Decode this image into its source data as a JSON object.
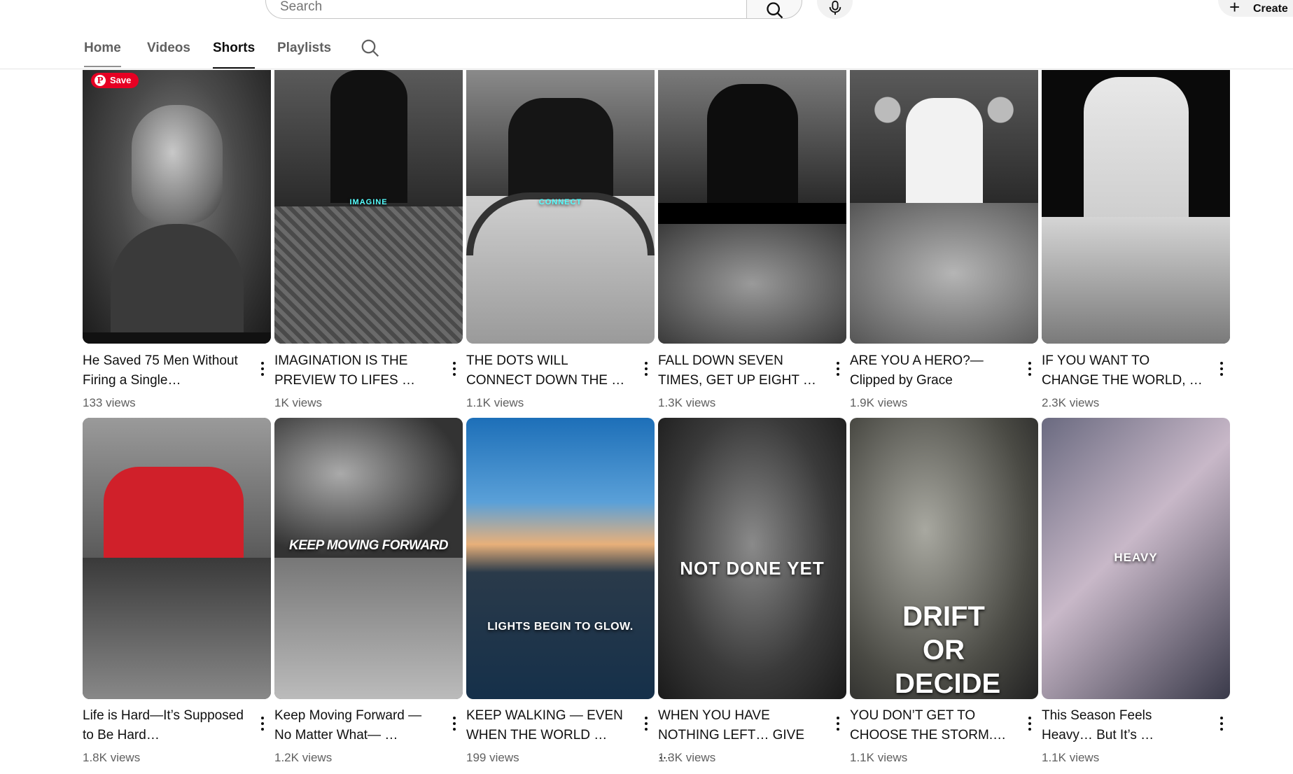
{
  "header": {
    "search_placeholder": "Search",
    "create_label": "Create"
  },
  "tabs": [
    {
      "label": "Home"
    },
    {
      "label": "Videos"
    },
    {
      "label": "Shorts"
    },
    {
      "label": "Playlists"
    }
  ],
  "active_tab": "Shorts",
  "pin_save_label": "Save",
  "shorts": [
    {
      "title": "He Saved 75 Men Without Firing a Single…",
      "views": "133 views"
    },
    {
      "title": "IMAGINATION IS THE PREVIEW TO LIFES …",
      "views": "1K views",
      "overlay": "IMAGINE"
    },
    {
      "title": "THE DOTS WILL CONNECT DOWN THE …",
      "views": "1.1K views",
      "overlay": "CONNECT"
    },
    {
      "title": "FALL DOWN SEVEN TIMES, GET UP EIGHT …",
      "views": "1.3K views"
    },
    {
      "title": "ARE YOU A HERO?— Clipped by Grace",
      "views": "1.9K views"
    },
    {
      "title": "IF YOU WANT TO CHANGE THE WORLD, …",
      "views": "2.3K views"
    },
    {
      "title": "Life is Hard—It’s Supposed to Be Hard…",
      "views": "1.8K views"
    },
    {
      "title": "Keep Moving Forward — No Matter What— …",
      "views": "1.2K views",
      "overlay": "KEEP MOVING FORWARD"
    },
    {
      "title": "KEEP WALKING — EVEN WHEN THE WORLD …",
      "views": "199 views",
      "overlay": "LIGHTS BEGIN TO GLOW."
    },
    {
      "title": "WHEN YOU HAVE NOTHING LEFT… GIVE …",
      "views": "1.3K views",
      "overlay": "NOT DONE YET"
    },
    {
      "title": "YOU DON’T GET TO CHOOSE THE STORM.…",
      "views": "1.1K views",
      "overlay": "DRIFT OR DECIDE"
    },
    {
      "title": "This Season Feels Heavy… But It’s …",
      "views": "1.1K views",
      "overlay": "HEAVY"
    }
  ],
  "icons": {
    "search": "search-icon",
    "mic": "microphone-icon",
    "plus": "plus-icon",
    "more": "more-vert-icon"
  }
}
